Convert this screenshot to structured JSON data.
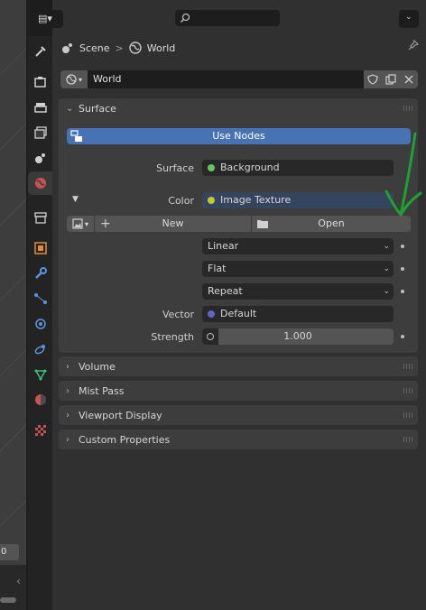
{
  "viewport": {
    "value_field": "0"
  },
  "header": {
    "editor_type_icon": "properties-editor-icon",
    "search_placeholder": ""
  },
  "breadcrumb": {
    "scene": "Scene",
    "separator": ">",
    "world": "World"
  },
  "datablock": {
    "name": "World"
  },
  "tabs": [
    "tool",
    "render",
    "output",
    "view-layer",
    "scene",
    "world",
    "collection",
    "object",
    "modifiers",
    "particles",
    "physics",
    "constraints",
    "data",
    "material",
    "texture"
  ],
  "surface_panel": {
    "title": "Surface",
    "use_nodes": "Use Nodes",
    "surface_label": "Surface",
    "surface_value": "Background",
    "color_label": "Color",
    "color_value": "Image Texture",
    "new_label": "New",
    "open_label": "Open",
    "interpolation": "Linear",
    "projection": "Flat",
    "extension": "Repeat",
    "vector_label": "Vector",
    "vector_value": "Default",
    "strength_label": "Strength",
    "strength_value": "1.000"
  },
  "collapsed_panels": [
    "Volume",
    "Mist Pass",
    "Viewport Display",
    "Custom Properties"
  ],
  "colors": {
    "accent": "#4772b3",
    "annotation": "#1fa033",
    "socket_yellow": "#c7c729",
    "socket_green": "#63c763",
    "socket_blue": "#6363c7"
  }
}
